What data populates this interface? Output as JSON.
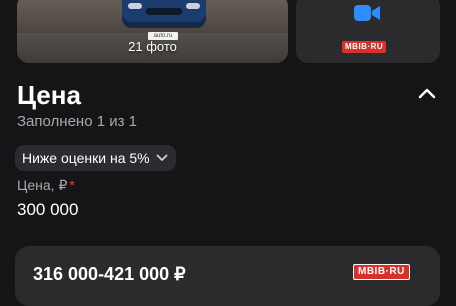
{
  "gallery": {
    "photo_count": "21 фото",
    "plate_text": "auto.ru",
    "video_icon": "video-camera-icon",
    "video_icon_color": "#2f8cff",
    "watermark": "MBIB·RU"
  },
  "price_section": {
    "title": "Цена",
    "collapse_icon": "chevron-up-icon",
    "filled_status": "Заполнено 1 из 1",
    "chip_label": "Ниже оценки на 5%",
    "chip_icon": "chevron-down-icon",
    "price_label": "Цена, ₽",
    "required_mark": "*",
    "price_value": "300 000"
  },
  "range_card": {
    "range_text": "316 000-421 000 ₽",
    "watermark": "MBIB·RU"
  },
  "colors": {
    "background": "#151517",
    "card": "#2b2b2e",
    "chip": "#2c2c30",
    "muted_text": "#a8a8ad",
    "required": "#e0453c",
    "watermark_red": "#d8312b"
  }
}
